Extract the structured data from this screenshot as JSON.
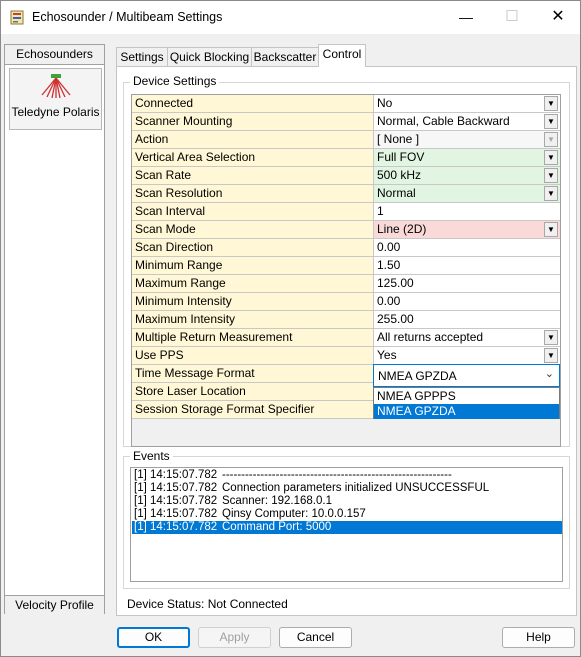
{
  "window": {
    "title": "Echosounder / Multibeam Settings",
    "title_icon": "app-settings-icon",
    "minimize": "—",
    "maximize": "☐",
    "close": "✕"
  },
  "left_panel": {
    "header": "Echosounders",
    "item": {
      "label": "Teledyne Polaris",
      "icon": "scanner-beam-icon"
    },
    "footer": "Velocity Profile"
  },
  "tabs": [
    "Settings",
    "Quick Blocking",
    "Backscatter",
    "Control"
  ],
  "active_tab": "Control",
  "device_settings": {
    "title": "Device Settings",
    "rows": [
      {
        "name": "Connected",
        "value": "No"
      },
      {
        "name": "Scanner Mounting",
        "value": "Normal, Cable Backward"
      },
      {
        "name": "Action",
        "value": "[ None ]"
      },
      {
        "name": "Vertical Area Selection",
        "value": "Full FOV"
      },
      {
        "name": "Scan Rate",
        "value": "500 kHz"
      },
      {
        "name": "Scan Resolution",
        "value": "Normal"
      },
      {
        "name": "Scan Interval",
        "value": "1"
      },
      {
        "name": "Scan Mode",
        "value": "Line (2D)"
      },
      {
        "name": "Scan Direction",
        "value": "0.00"
      },
      {
        "name": "Minimum Range",
        "value": "1.50"
      },
      {
        "name": "Maximum Range",
        "value": "125.00"
      },
      {
        "name": "Minimum Intensity",
        "value": "0.00"
      },
      {
        "name": "Maximum Intensity",
        "value": "255.00"
      },
      {
        "name": "Multiple Return Measurement",
        "value": "All returns accepted"
      },
      {
        "name": "Use PPS",
        "value": "Yes"
      },
      {
        "name": "Time Message Format",
        "value": "NMEA GPZDA"
      },
      {
        "name": "Store Laser Location",
        "value": ""
      },
      {
        "name": "Session Storage Format Specifier",
        "value": ""
      }
    ],
    "time_format_dropdown": {
      "selected": "NMEA GPZDA",
      "options": [
        "NMEA GPPPS",
        "NMEA GPZDA"
      ]
    }
  },
  "events": {
    "title": "Events",
    "items": [
      {
        "time": "[1] 14:15:07.782",
        "text": "------------------------------------------------------------"
      },
      {
        "time": "[1] 14:15:07.782",
        "text": "Connection parameters initialized UNSUCCESSFUL"
      },
      {
        "time": "[1] 14:15:07.782",
        "text": "Scanner: 192.168.0.1"
      },
      {
        "time": "[1] 14:15:07.782",
        "text": "Qinsy Computer: 10.0.0.157"
      },
      {
        "time": "[1] 14:15:07.782",
        "text": "Command Port: 5000"
      }
    ]
  },
  "status": "Device Status: Not Connected",
  "buttons": {
    "ok": "OK",
    "apply": "Apply",
    "cancel": "Cancel",
    "help": "Help"
  },
  "colors": {
    "accent": "#0078d4",
    "name_cell": "#fff7d6",
    "value_green": "#e2f5e2",
    "value_pink": "#fad9d9"
  }
}
